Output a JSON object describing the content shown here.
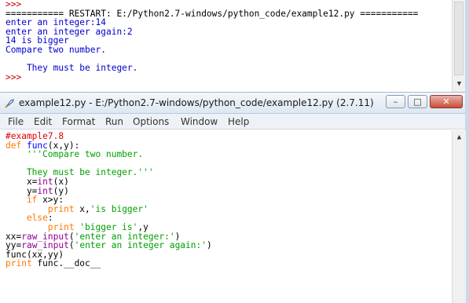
{
  "shell": {
    "lines": [
      {
        "text": ">>>",
        "cls": "c-prompt"
      },
      {
        "text": "=========== RESTART: E:/Python2.7-windows/python_code/example12.py ===========",
        "cls": "c-black"
      },
      {
        "text": "enter an integer:14",
        "cls": "c-out"
      },
      {
        "text": "enter an integer again:2",
        "cls": "c-out"
      },
      {
        "text": "14 is bigger",
        "cls": "c-out"
      },
      {
        "text": "Compare two number.",
        "cls": "c-out"
      },
      {
        "text": "",
        "cls": "c-out"
      },
      {
        "text": "    They must be integer.",
        "cls": "c-out"
      },
      {
        "text": ">>>",
        "cls": "c-prompt"
      }
    ]
  },
  "window": {
    "title": "example12.py - E:/Python2.7-windows/python_code/example12.py (2.7.11)",
    "minimize_label": "–",
    "maximize_label": "□",
    "close_label": "✕"
  },
  "menu": [
    "File",
    "Edit",
    "Format",
    "Run",
    "Options",
    "Window",
    "Help"
  ],
  "editor": {
    "lines": [
      [
        {
          "t": "#example7.8",
          "c": "c-comment"
        }
      ],
      [
        {
          "t": "def ",
          "c": "c-kw"
        },
        {
          "t": "func",
          "c": "c-def"
        },
        {
          "t": "(x,y):",
          "c": "c-black"
        }
      ],
      [
        {
          "t": "    '''Compare two number.",
          "c": "c-green"
        }
      ],
      [
        {
          "t": "",
          "c": "c-black"
        }
      ],
      [
        {
          "t": "    They must be integer.'''",
          "c": "c-green"
        }
      ],
      [
        {
          "t": "    x=",
          "c": "c-black"
        },
        {
          "t": "int",
          "c": "c-builtin"
        },
        {
          "t": "(x)",
          "c": "c-black"
        }
      ],
      [
        {
          "t": "    y=",
          "c": "c-black"
        },
        {
          "t": "int",
          "c": "c-builtin"
        },
        {
          "t": "(y)",
          "c": "c-black"
        }
      ],
      [
        {
          "t": "    if ",
          "c": "c-kw"
        },
        {
          "t": "x>y:",
          "c": "c-black"
        }
      ],
      [
        {
          "t": "        print ",
          "c": "c-kw"
        },
        {
          "t": "x,",
          "c": "c-black"
        },
        {
          "t": "'is bigger'",
          "c": "c-green"
        }
      ],
      [
        {
          "t": "    else",
          "c": "c-kw"
        },
        {
          "t": ":",
          "c": "c-black"
        }
      ],
      [
        {
          "t": "        print ",
          "c": "c-kw"
        },
        {
          "t": "'bigger is'",
          "c": "c-green"
        },
        {
          "t": ",y",
          "c": "c-black"
        }
      ],
      [
        {
          "t": "xx=",
          "c": "c-black"
        },
        {
          "t": "raw_input",
          "c": "c-builtin"
        },
        {
          "t": "(",
          "c": "c-black"
        },
        {
          "t": "'enter an integer:'",
          "c": "c-green"
        },
        {
          "t": ")",
          "c": "c-black"
        }
      ],
      [
        {
          "t": "yy=",
          "c": "c-black"
        },
        {
          "t": "raw_input",
          "c": "c-builtin"
        },
        {
          "t": "(",
          "c": "c-black"
        },
        {
          "t": "'enter an integer again:'",
          "c": "c-green"
        },
        {
          "t": ")",
          "c": "c-black"
        }
      ],
      [
        {
          "t": "func(xx,yy)",
          "c": "c-black"
        }
      ],
      [
        {
          "t": "print ",
          "c": "c-kw"
        },
        {
          "t": "func.__doc__",
          "c": "c-black"
        }
      ]
    ]
  },
  "icons": {
    "app": "python-feather-icon",
    "scroll_down": "scroll-down-arrow-icon",
    "scroll_up": "scroll-up-arrow-icon"
  }
}
